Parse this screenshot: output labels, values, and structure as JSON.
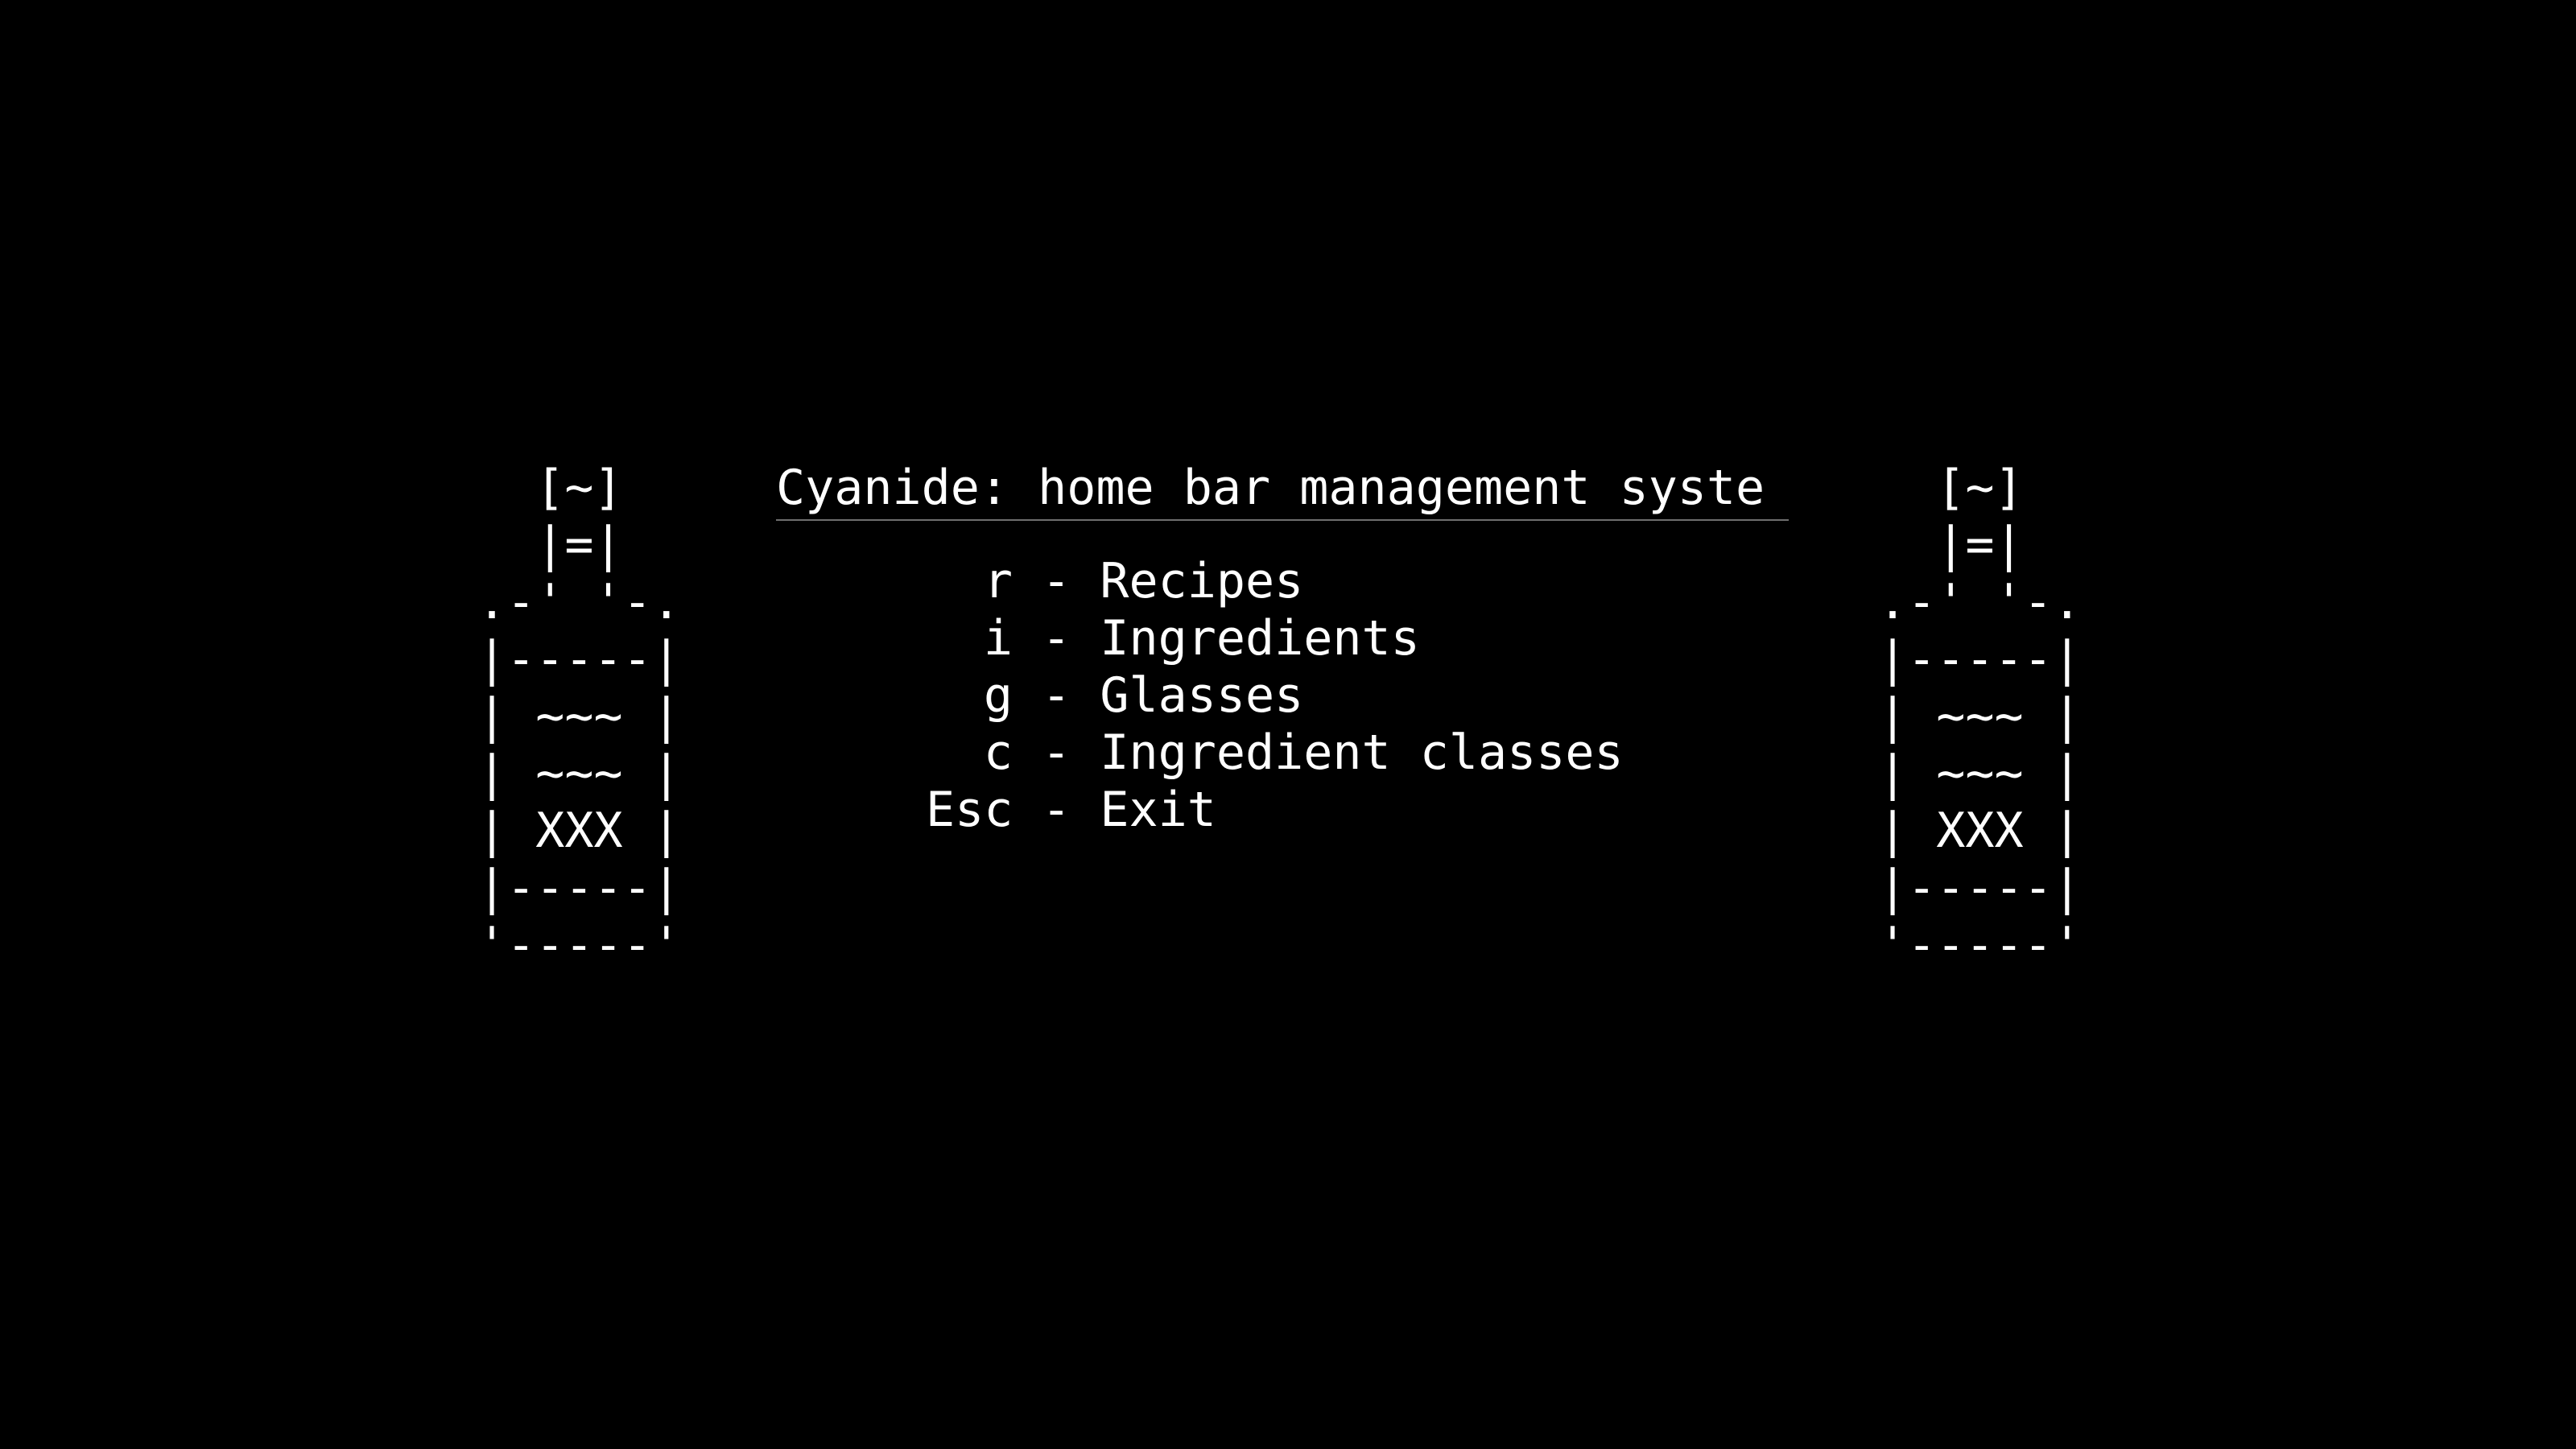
{
  "colors": {
    "background": "#000000",
    "foreground": "#ffffff",
    "divider": "#6e6e6e"
  },
  "art": {
    "bottle": "  [~]\n  |=|\n.-' '-.\n|-----|\n| ~~~ |\n| ~~~ |\n| XXX |\n|-----|\n'-----'"
  },
  "title": "Cyanide: home bar management syste",
  "menu": {
    "items": [
      {
        "key": "r",
        "sep": " - ",
        "label": "Recipes"
      },
      {
        "key": "i",
        "sep": " - ",
        "label": "Ingredients"
      },
      {
        "key": "g",
        "sep": " - ",
        "label": "Glasses"
      },
      {
        "key": "c",
        "sep": " - ",
        "label": "Ingredient classes"
      },
      {
        "key": "Esc",
        "sep": " - ",
        "label": "Exit"
      }
    ]
  }
}
